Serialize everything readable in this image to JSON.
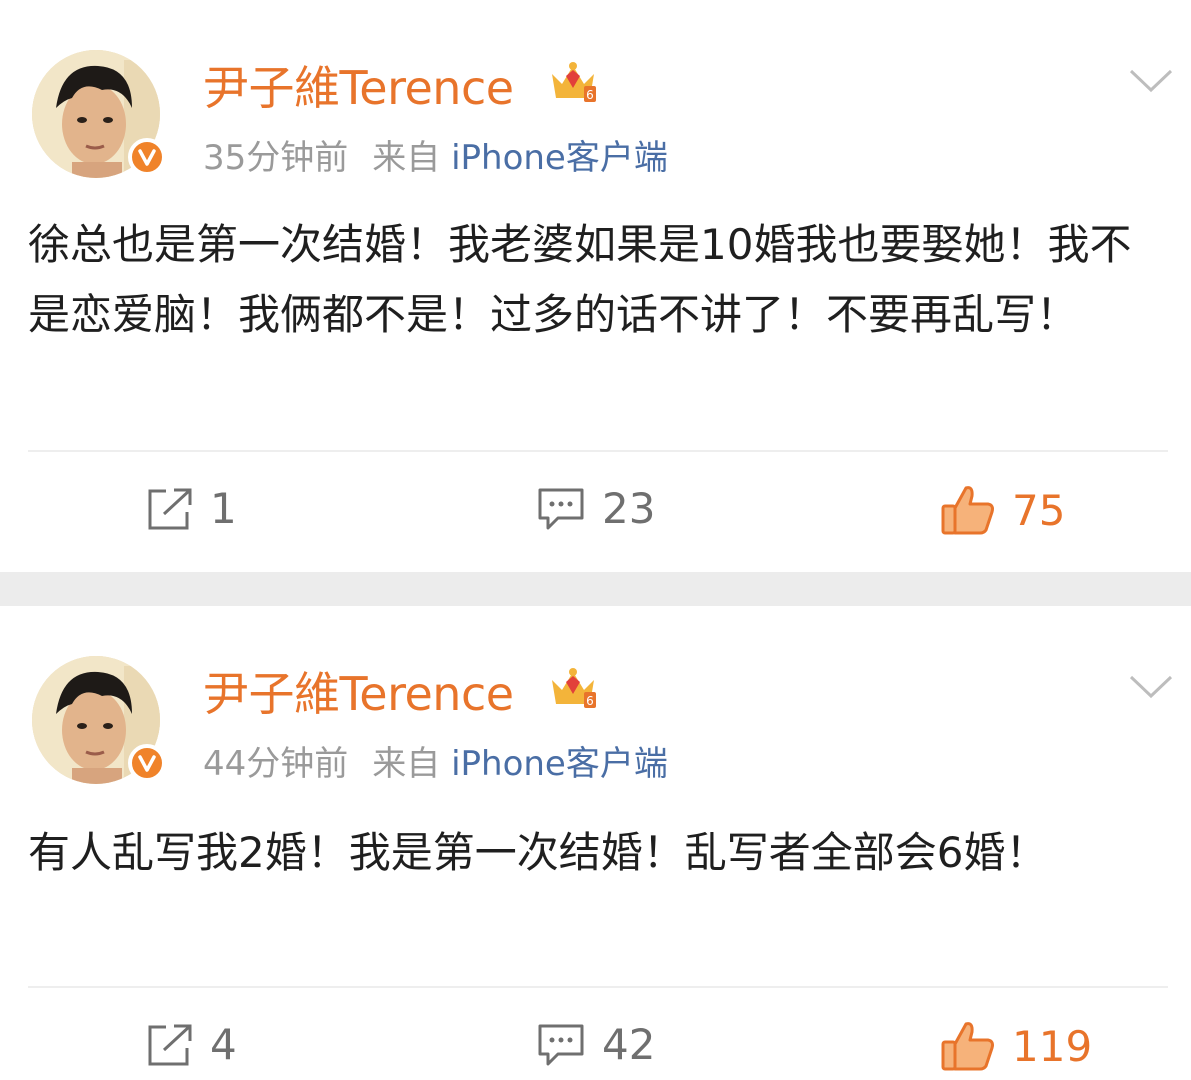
{
  "posts": [
    {
      "username": "尹子維Terence",
      "time": "35分钟前",
      "source_label": "来自",
      "source_app": "iPhone客户端",
      "content": "徐总也是第一次结婚！我老婆如果是10婚我也要娶她！我不是恋爱脑！我俩都不是！过多的话不讲了！不要再乱写！",
      "shares": "1",
      "comments": "23",
      "likes": "75"
    },
    {
      "username": "尹子維Terence",
      "time": "44分钟前",
      "source_label": "来自",
      "source_app": "iPhone客户端",
      "content": "有人乱写我2婚！我是第一次结婚！乱写者全部会6婚！",
      "shares": "4",
      "comments": "42",
      "likes": "119"
    }
  ],
  "colors": {
    "accent": "#e8742b",
    "link": "#4a6ea5",
    "meta": "#9a9a9a",
    "separator": "#ececec"
  },
  "icons": {
    "avatar": "avatar",
    "verified": "verified-v-icon",
    "member_crown": "crown-vip-icon",
    "more": "chevron-down-icon",
    "share": "repost-icon",
    "comment": "comment-icon",
    "like": "thumbs-up-icon"
  }
}
